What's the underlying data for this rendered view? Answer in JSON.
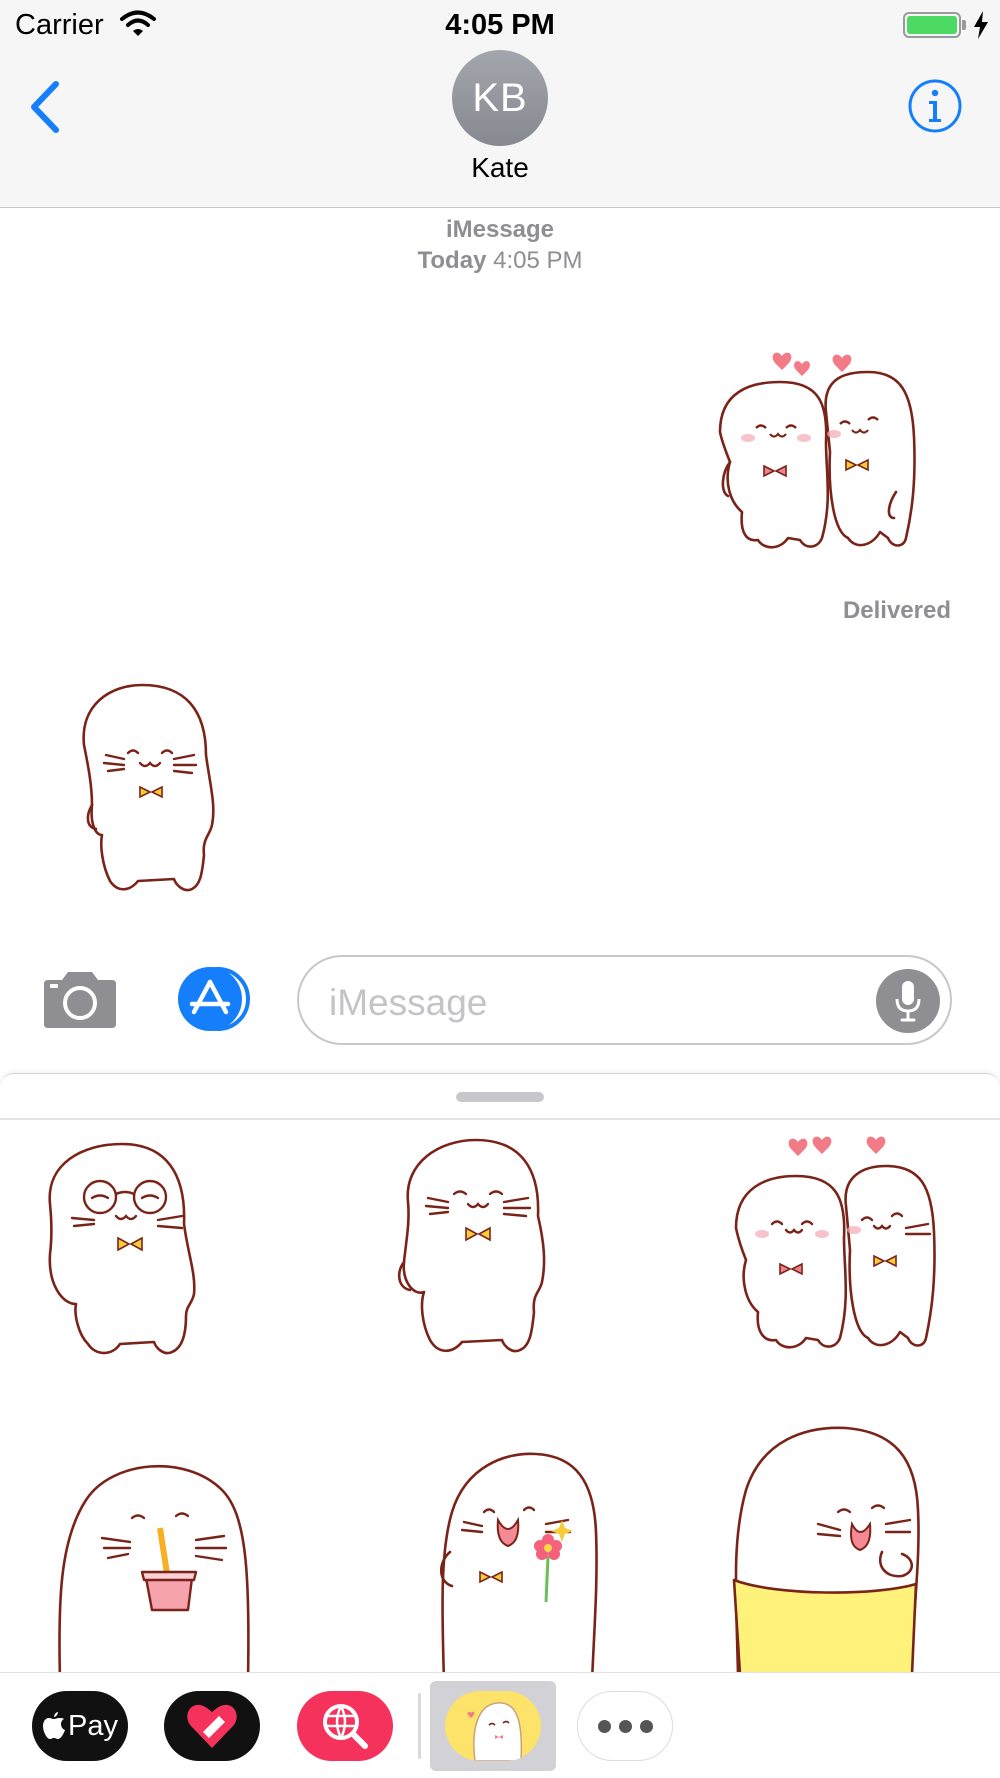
{
  "status_bar": {
    "carrier": "Carrier",
    "time": "4:05 PM",
    "battery_color": "#4cd964",
    "icons": [
      "wifi-icon",
      "battery-icon",
      "charging-bolt-icon"
    ]
  },
  "header": {
    "avatar_initials": "KB",
    "contact_name": "Kate",
    "accent_color": "#147efb",
    "icons": [
      "chevron-left-icon",
      "info-icon"
    ]
  },
  "conversation": {
    "service": "iMessage",
    "date_label": "Today",
    "time_label": "4:05 PM",
    "delivered_label": "Delivered",
    "messages": [
      {
        "from": "me",
        "content": "seal-couple-hearts-sticker"
      },
      {
        "from": "Kate",
        "content": "seal-standing-sticker"
      }
    ]
  },
  "input_bar": {
    "placeholder": "iMessage",
    "icons": [
      "camera-icon",
      "app-store-icon",
      "microphone-icon"
    ]
  },
  "sticker_drawer": {
    "stickers": [
      "seal-glasses",
      "seal-standing",
      "seal-couple-hearts",
      "seal-drinking",
      "seal-flower",
      "seal-yellow-pants"
    ]
  },
  "app_strip": {
    "apple_pay_label": "Pay",
    "apps": [
      "apple-pay",
      "heart-stickers-app",
      "search-images-app",
      "seal-stickers-app",
      "more-apps"
    ],
    "colors": {
      "search_app": "#f5325c",
      "selected_app_bg": "#fde36a"
    }
  }
}
